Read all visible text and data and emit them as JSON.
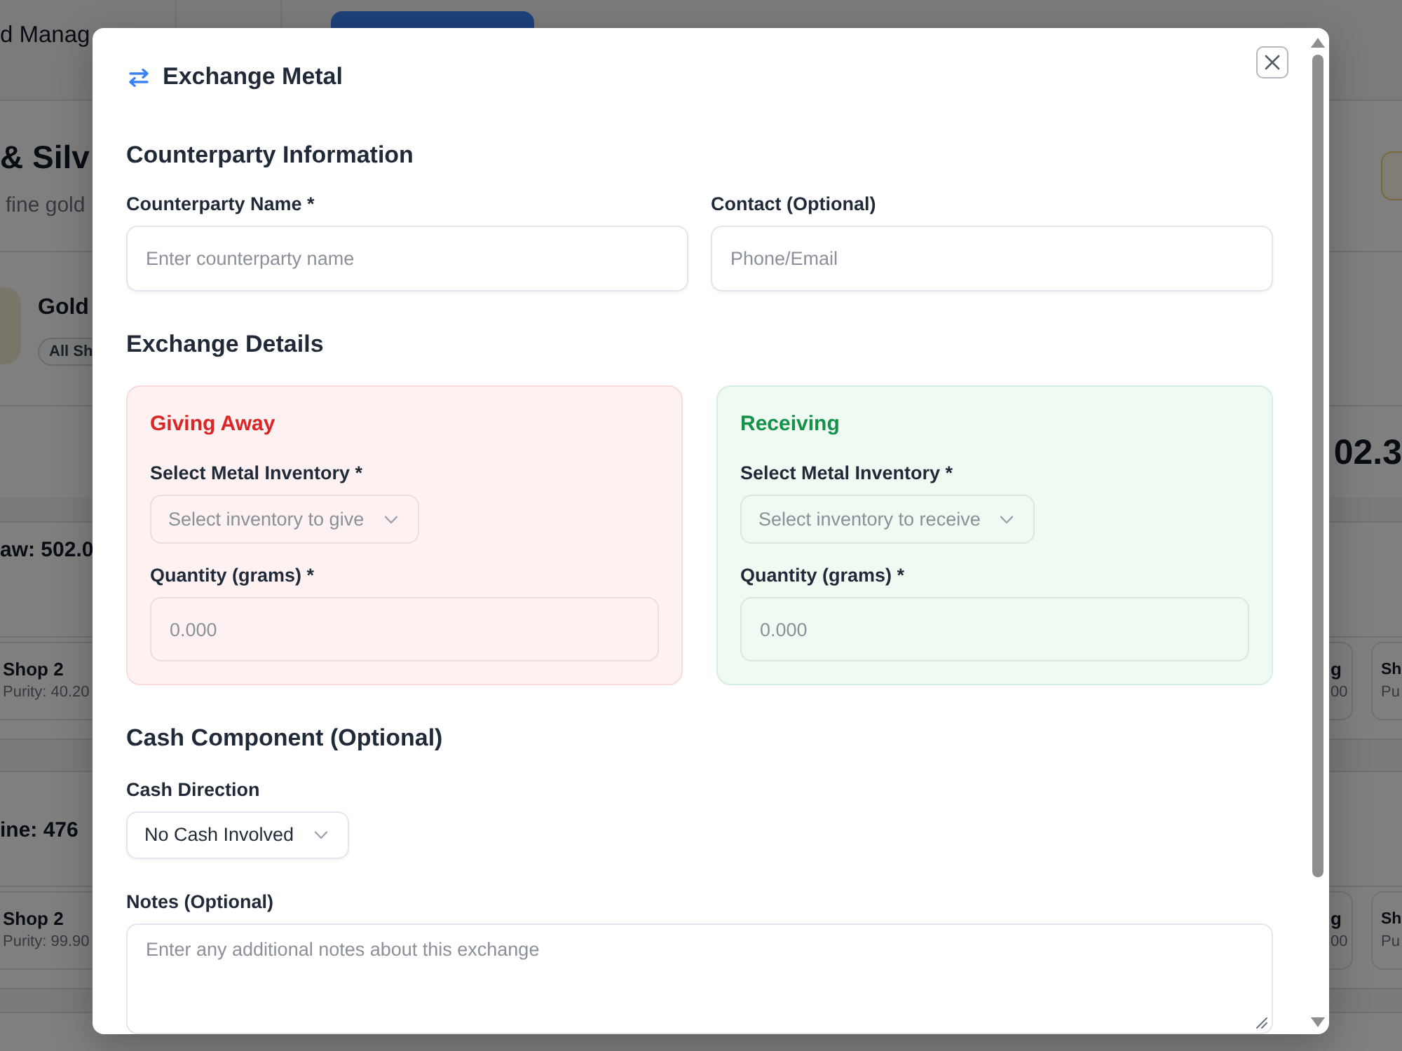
{
  "background": {
    "header": {
      "title": "d Manag"
    },
    "intro": {
      "heading": "& Silv",
      "subtitle": "fine gold"
    },
    "metal": {
      "name": "Gold",
      "badge": "All Sh"
    },
    "total": "02.3",
    "groups": [
      {
        "summary": "aw: 502.0",
        "left_card": {
          "name": "Shop 2",
          "purity": "Purity: 40.20"
        },
        "right_cards": [
          {
            "line_1": "g",
            "line_2": "00"
          },
          {
            "line_1": "Sh",
            "line_2": "Pu"
          }
        ]
      },
      {
        "summary": "ine: 476",
        "left_card": {
          "name": "Shop 2",
          "purity": "Purity: 99.90"
        },
        "right_cards": [
          {
            "line_1": "g",
            "line_2": "00"
          },
          {
            "line_1": "Sh",
            "line_2": "Pu"
          }
        ]
      }
    ]
  },
  "dialog": {
    "title": "Exchange Metal",
    "counterparty": {
      "heading": "Counterparty Information",
      "fields": [
        {
          "label": "Counterparty Name *",
          "placeholder": "Enter counterparty name"
        },
        {
          "label": "Contact (Optional)",
          "placeholder": "Phone/Email"
        }
      ]
    },
    "exchange": {
      "heading": "Exchange Details",
      "panels": [
        {
          "kind": "give",
          "title": "Giving Away",
          "inventory_label": "Select Metal Inventory *",
          "inventory_placeholder": "Select inventory to give",
          "quantity_label": "Quantity (grams) *",
          "quantity_placeholder": "0.000"
        },
        {
          "kind": "receive",
          "title": "Receiving",
          "inventory_label": "Select Metal Inventory *",
          "inventory_placeholder": "Select inventory to receive",
          "quantity_label": "Quantity (grams) *",
          "quantity_placeholder": "0.000"
        }
      ]
    },
    "cash": {
      "heading": "Cash Component (Optional)",
      "direction_label": "Cash Direction",
      "direction_value": "No Cash Involved"
    },
    "notes": {
      "label": "Notes (Optional)",
      "placeholder": "Enter any additional notes about this exchange"
    }
  }
}
